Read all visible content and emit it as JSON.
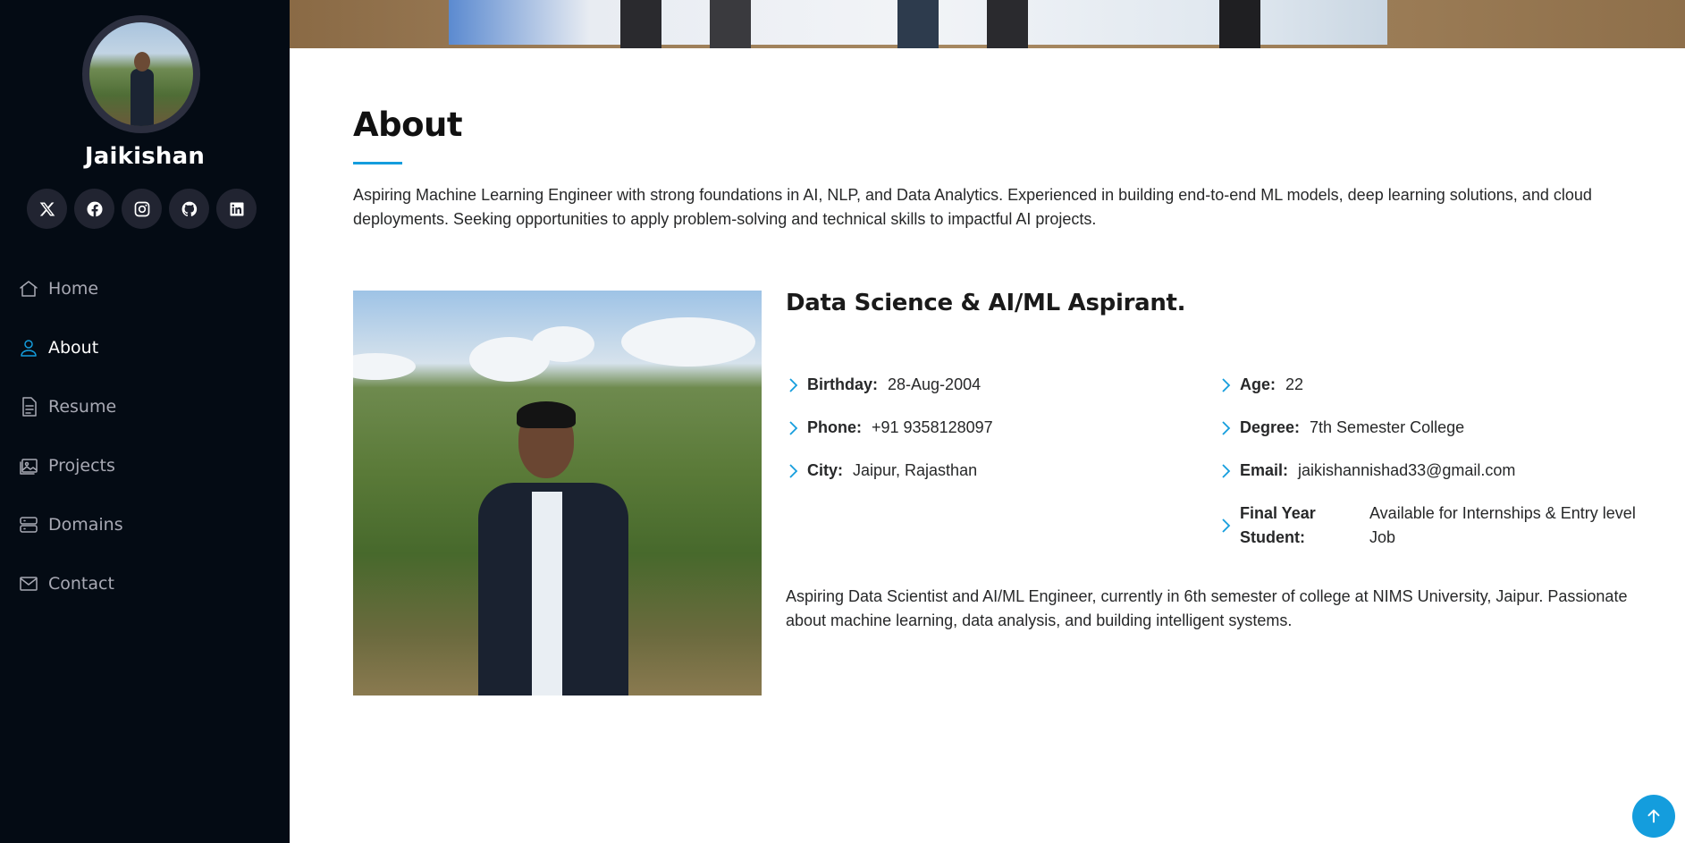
{
  "sidebar": {
    "profile_name": "Jaikishan",
    "social": [
      {
        "icon": "x-twitter-icon"
      },
      {
        "icon": "facebook-icon"
      },
      {
        "icon": "instagram-icon"
      },
      {
        "icon": "github-icon"
      },
      {
        "icon": "linkedin-icon"
      }
    ],
    "nav": [
      {
        "label": "Home",
        "icon": "house-icon",
        "active": false
      },
      {
        "label": "About",
        "icon": "person-icon",
        "active": true
      },
      {
        "label": "Resume",
        "icon": "file-text-icon",
        "active": false
      },
      {
        "label": "Projects",
        "icon": "images-icon",
        "active": false
      },
      {
        "label": "Domains",
        "icon": "server-icon",
        "active": false
      },
      {
        "label": "Contact",
        "icon": "envelope-icon",
        "active": false
      }
    ]
  },
  "about": {
    "title": "About",
    "intro": "Aspiring Machine Learning Engineer with strong foundations in AI, NLP, and Data Analytics. Experienced in building end-to-end ML models, deep learning solutions, and cloud deployments. Seeking opportunities to apply problem-solving and technical skills to impactful AI projects.",
    "subtitle": "Data Science & AI/ML Aspirant.",
    "left_info": [
      {
        "key": "Birthday:",
        "value": "28-Aug-2004"
      },
      {
        "key": "Phone:",
        "value": "+91 9358128097"
      },
      {
        "key": "City:",
        "value": "Jaipur, Rajasthan"
      }
    ],
    "right_info": [
      {
        "key": "Age:",
        "value": "22"
      },
      {
        "key": "Degree:",
        "value": "7th Semester College"
      },
      {
        "key": "Email:",
        "value": "jaikishannishad33@gmail.com"
      },
      {
        "key": "Final Year Student:",
        "value": "Available for Internships & Entry level Job"
      }
    ],
    "bio": "Aspiring Data Scientist and AI/ML Engineer, currently in 6th semester of college at NIMS University, Jaipur. Passionate about machine learning, data analysis, and building intelligent systems."
  },
  "accent_color": "#149ddd",
  "sidebar_bg": "#040b14"
}
